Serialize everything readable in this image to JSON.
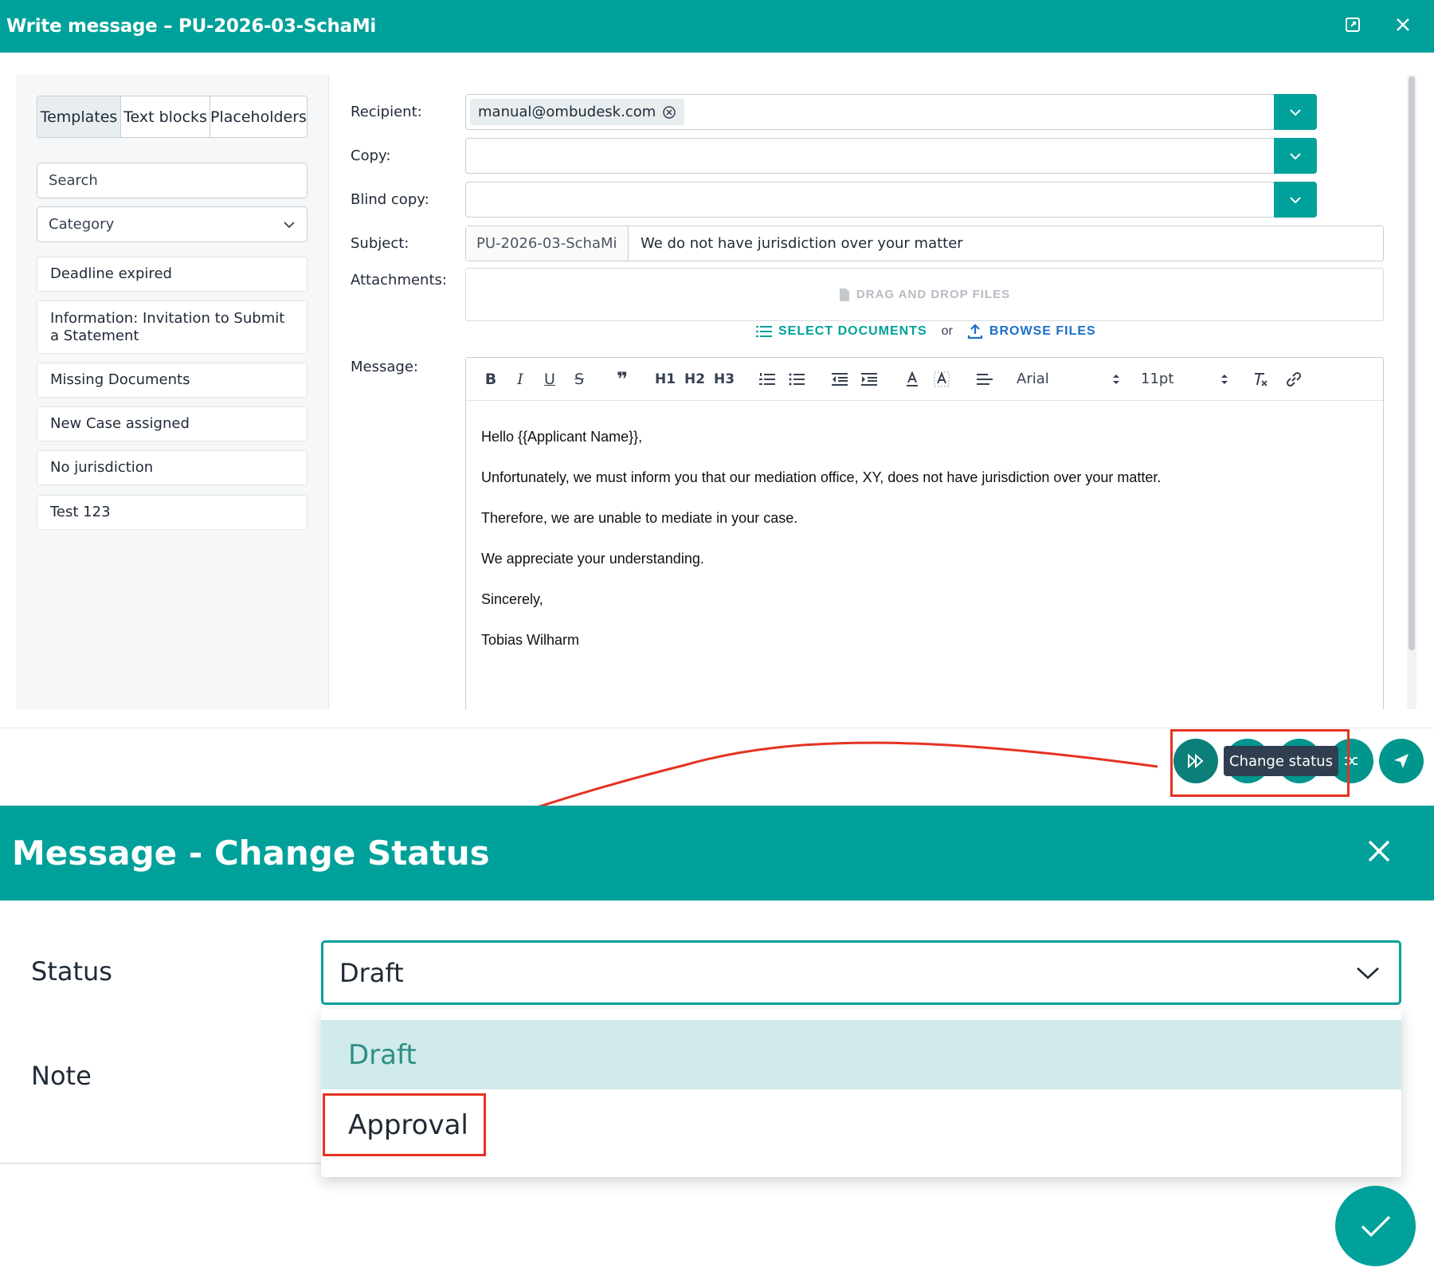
{
  "window": {
    "title": "Write message – PU-2026-03-SchaMi",
    "expand_icon": "expand-icon",
    "close_icon": "close-icon"
  },
  "sidebar": {
    "tabs": [
      {
        "label": "Templates",
        "active": true
      },
      {
        "label": "Text blocks",
        "active": false
      },
      {
        "label": "Placeholders",
        "active": false
      }
    ],
    "search_placeholder": "Search",
    "category_placeholder": "Category",
    "templates": [
      "Deadline expired",
      "Information: Invitation to Submit a Statement",
      "Missing Documents",
      "New Case assigned",
      "No jurisdiction",
      "Test 123"
    ]
  },
  "form": {
    "recipient_label": "Recipient:",
    "recipient_chip": "manual@ombudesk.com",
    "copy_label": "Copy:",
    "blind_copy_label": "Blind copy:",
    "subject_label": "Subject:",
    "subject_prefix": "PU-2026-03-SchaMi",
    "subject_value": "We do not have jurisdiction over your matter",
    "attachments_label": "Attachments:",
    "drop_text": "DRAG AND DROP FILES",
    "select_documents": "SELECT DOCUMENTS",
    "or_text": "or",
    "browse_files": "BROWSE FILES",
    "message_label": "Message:"
  },
  "editor": {
    "toolbar": {
      "bold": "B",
      "italic": "I",
      "underline": "U",
      "strike": "S",
      "quote": "❞",
      "h1": "H1",
      "h2": "H2",
      "h3": "H3",
      "font": "Arial",
      "size": "11pt"
    },
    "lines": [
      "Hello {{Applicant Name}},",
      "Unfortunately, we must inform you that our mediation office, XY, does not have jurisdiction over your matter.",
      "Therefore, we are unable to mediate in your case.",
      "We appreciate your understanding.",
      "Sincerely,",
      "Tobias Wilharm"
    ]
  },
  "actions": {
    "tooltip": "Change status"
  },
  "status_dialog": {
    "title": "Message - Change Status",
    "status_label": "Status",
    "note_label": "Note",
    "selected_value": "Draft",
    "options": [
      "Draft",
      "Approval"
    ]
  },
  "colors": {
    "primary": "#00a19a",
    "annotation": "#e53222"
  }
}
